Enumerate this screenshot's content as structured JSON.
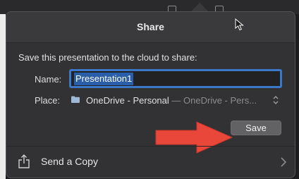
{
  "dialog": {
    "title": "Share",
    "prompt": "Save this presentation to the cloud to share:",
    "name_label": "Name:",
    "name_value": "Presentation1",
    "place_label": "Place:",
    "place_folder": "OneDrive - Personal",
    "place_separator": "—",
    "place_path": "OneDrive - Pers...",
    "save_label": "Save",
    "send_copy_label": "Send a Copy"
  },
  "icons": {
    "folder": "folder-icon",
    "place_stepper": "updown-chevron-icon",
    "share": "share-box-icon",
    "send_chevron": "chevron-right-icon",
    "cursor": "mouse-pointer-icon",
    "annotation": "red-arrow-annotation"
  },
  "colors": {
    "panel": "#323234",
    "titlebar": "#3a3a3c",
    "input_focus": "#3c78c9",
    "selection": "#2a5ea8",
    "button": "#626264",
    "arrow": "#e8473a"
  }
}
